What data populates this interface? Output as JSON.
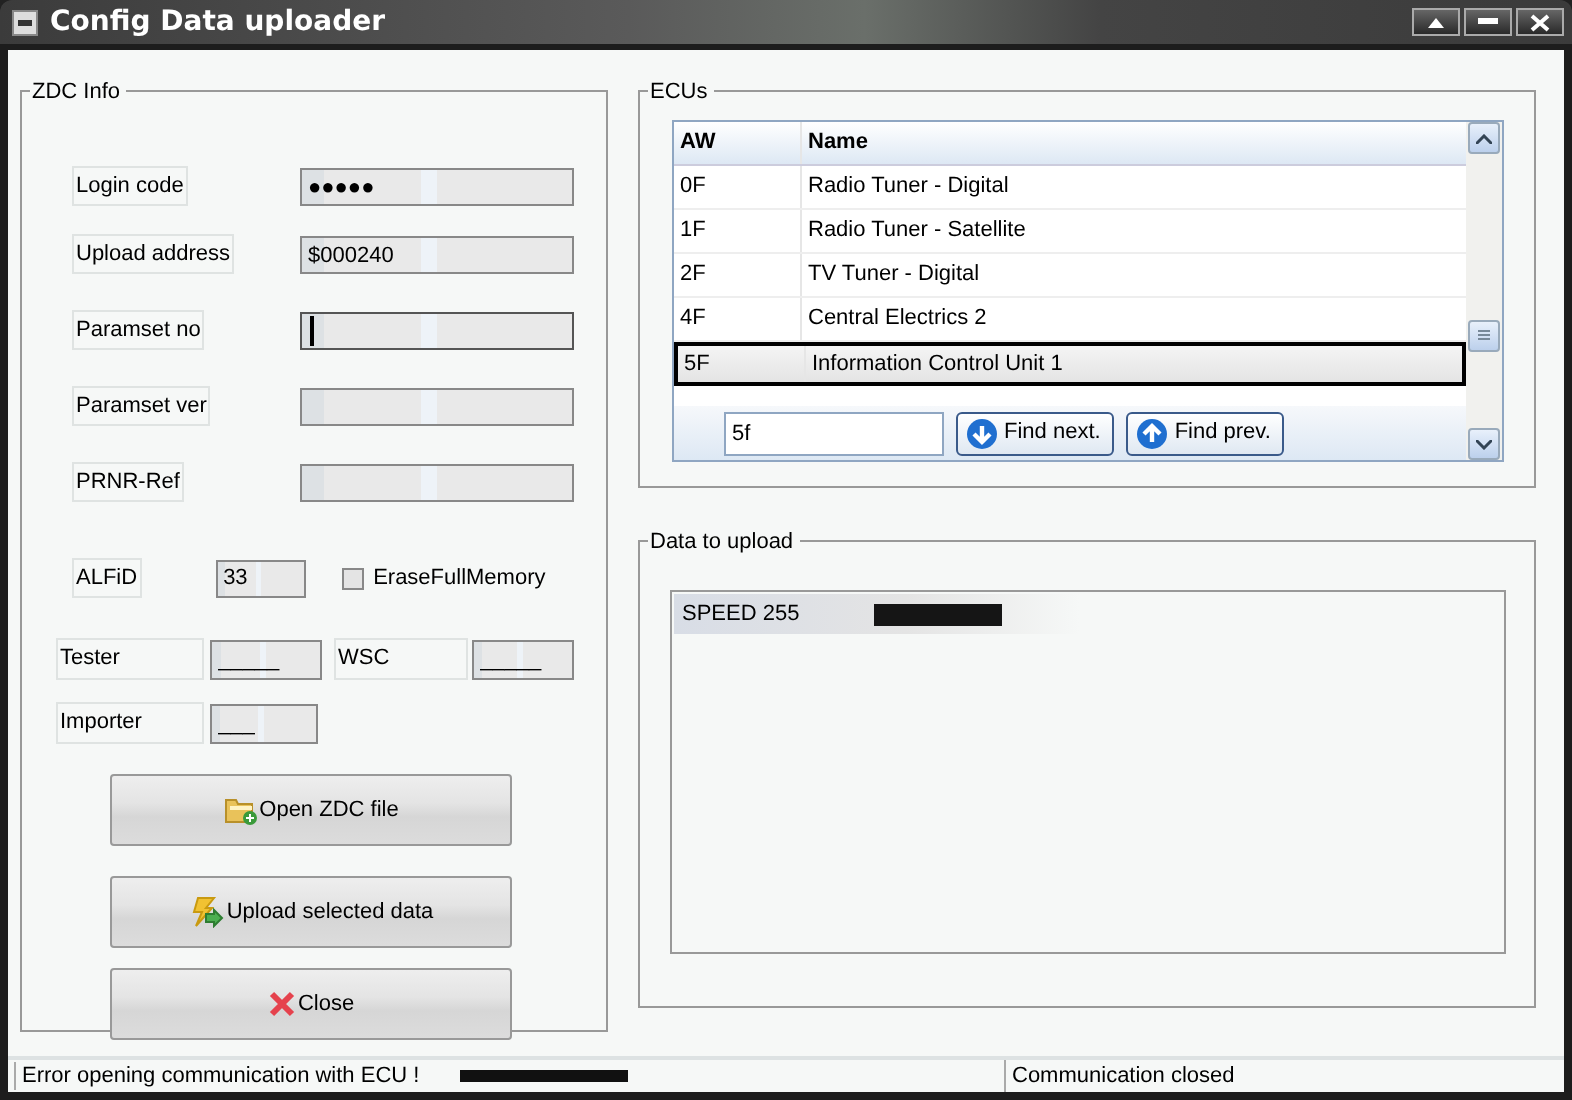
{
  "window": {
    "title": "Config Data uploader"
  },
  "zdc_info": {
    "title": "ZDC Info",
    "fields": [
      {
        "label": "Login code",
        "value": "●●●●●",
        "focused": false
      },
      {
        "label": "Upload address",
        "value": "$000240",
        "focused": false
      },
      {
        "label": "Paramset no",
        "focused": true
      },
      {
        "label": "Paramset ver",
        "focused": false
      },
      {
        "label": "PRNR-Ref",
        "focused": false
      }
    ],
    "alfid": {
      "label": "ALFiD",
      "value": "33"
    },
    "erase_full_memory": {
      "label": "EraseFullMemory",
      "checked": false
    },
    "tester": {
      "label": "Tester",
      "value": "_____"
    },
    "wsc": {
      "label": "WSC",
      "value": "_____"
    },
    "importer": {
      "label": "Importer",
      "value": "___"
    },
    "buttons": [
      {
        "label": "Open ZDC file",
        "kind": "open"
      },
      {
        "label": "Upload selected data",
        "kind": "upload"
      },
      {
        "label": "Close",
        "kind": "close"
      }
    ]
  },
  "ecus": {
    "title": "ECUs",
    "columns": [
      "AW",
      "Name"
    ],
    "rows": [
      {
        "aw": "0F",
        "name": "Radio Tuner - Digital",
        "selected": false
      },
      {
        "aw": "1F",
        "name": "Radio Tuner - Satellite",
        "selected": false
      },
      {
        "aw": "2F",
        "name": "TV Tuner - Digital",
        "selected": false
      },
      {
        "aw": "4F",
        "name": "Central Electrics 2",
        "selected": false
      },
      {
        "aw": "5F",
        "name": "Information Control Unit 1",
        "selected": true
      }
    ],
    "search": {
      "value": "5f"
    },
    "find_buttons": [
      {
        "label": "Find next.",
        "kind": "down"
      },
      {
        "label": "Find prev.",
        "kind": "up"
      }
    ]
  },
  "data_to_upload": {
    "title": "Data to upload",
    "items": [
      {
        "text": "SPEED 255"
      }
    ]
  },
  "status_bar": {
    "message": "Error opening communication with ECU !",
    "connection": "Communication closed"
  }
}
